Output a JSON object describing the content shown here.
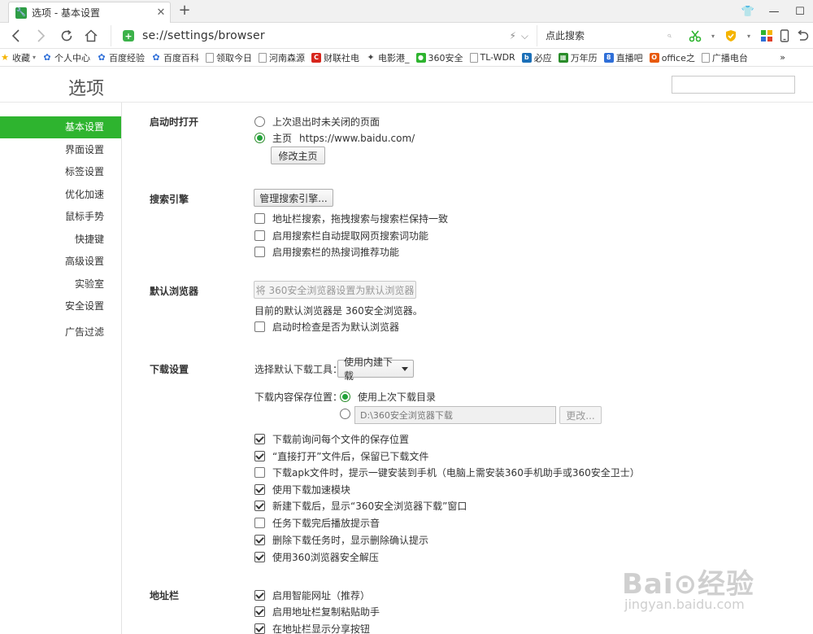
{
  "tab": {
    "title": "选项 - 基本设置",
    "close": "✕",
    "new": "+"
  },
  "window": {
    "skin": "👕",
    "minimize": "—",
    "maximize": "☐"
  },
  "toolbar": {
    "url": "se://settings/browser",
    "search_placeholder": "点此搜索",
    "lightning": "⚡",
    "dropdown": "⌵"
  },
  "bookmarks": [
    {
      "label": "收藏",
      "icon": "star-icon",
      "color": "#f5b400"
    },
    {
      "label": "个人中心",
      "icon": "paw-icon",
      "color": "#2f6fd8"
    },
    {
      "label": "百度经验",
      "icon": "paw-icon",
      "color": "#2f6fd8"
    },
    {
      "label": "百度百科",
      "icon": "paw-icon",
      "color": "#2f6fd8"
    },
    {
      "label": "领取今日",
      "icon": "page-icon",
      "color": "#9a9a9a"
    },
    {
      "label": "河南森源",
      "icon": "page-icon",
      "color": "#9a9a9a"
    },
    {
      "label": "财联社电",
      "icon": "c-icon",
      "color": "#d7261d"
    },
    {
      "label": "电影港_",
      "icon": "film-icon",
      "color": "#444444"
    },
    {
      "label": "360安全",
      "icon": "360-icon",
      "color": "#2eb42f"
    },
    {
      "label": "TL-WDR",
      "icon": "page-icon",
      "color": "#9a9a9a"
    },
    {
      "label": "必应",
      "icon": "bing-icon",
      "color": "#1b6fb8"
    },
    {
      "label": "万年历",
      "icon": "calendar-icon",
      "color": "#2a8c2a"
    },
    {
      "label": "直播吧",
      "icon": "live-icon",
      "color": "#2f6fd8"
    },
    {
      "label": "office之",
      "icon": "office-icon",
      "color": "#e85a0c"
    },
    {
      "label": "广播电台",
      "icon": "page-icon",
      "color": "#9a9a9a"
    }
  ],
  "bookmarks_more": "»",
  "header": {
    "title": "选项"
  },
  "sidebar": {
    "items": [
      {
        "label": "基本设置",
        "active": true
      },
      {
        "label": "界面设置"
      },
      {
        "label": "标签设置"
      },
      {
        "label": "优化加速"
      },
      {
        "label": "鼠标手势"
      },
      {
        "label": "快捷键"
      },
      {
        "label": "高级设置"
      },
      {
        "label": "实验室"
      },
      {
        "label": "安全设置"
      },
      {
        "label": "广告过滤"
      }
    ]
  },
  "startup": {
    "label": "启动时打开",
    "opt_last": "上次退出时未关闭的页面",
    "opt_home": "主页",
    "home_url": "https://www.baidu.com/",
    "modify_home": "修改主页"
  },
  "search_engine": {
    "label": "搜索引擎",
    "manage": "管理搜索引擎...",
    "opt1": "地址栏搜索，拖拽搜索与搜索栏保持一致",
    "opt2": "启用搜索栏自动提取网页搜索词功能",
    "opt3": "启用搜索栏的热搜词推荐功能"
  },
  "default_browser": {
    "label": "默认浏览器",
    "set_default": "将 360安全浏览器设置为默认浏览器",
    "current": "目前的默认浏览器是 360安全浏览器。",
    "check_startup": "启动时检查是否为默认浏览器"
  },
  "download": {
    "label": "下载设置",
    "tool_label": "选择默认下载工具：",
    "tool_value": "使用内建下载",
    "location_label": "下载内容保存位置：",
    "use_last": "使用上次下载目录",
    "path": "D:\\360安全浏览器下载",
    "change": "更改...",
    "opts": [
      {
        "text": "下载前询问每个文件的保存位置",
        "checked": true
      },
      {
        "text": "“直接打开”文件后，保留已下载文件",
        "checked": true
      },
      {
        "text": "下载apk文件时，提示一键安装到手机（电脑上需安装360手机助手或360安全卫士）",
        "checked": false
      },
      {
        "text": "使用下载加速模块",
        "checked": true
      },
      {
        "text": "新建下载后，显示“360安全浏览器下载”窗口",
        "checked": true
      },
      {
        "text": "任务下载完后播放提示音",
        "checked": false
      },
      {
        "text": "删除下载任务时，显示删除确认提示",
        "checked": true
      },
      {
        "text": "使用360浏览器安全解压",
        "checked": true
      }
    ]
  },
  "addressbar": {
    "label": "地址栏",
    "opts": [
      {
        "text": "启用智能网址（推荐）",
        "checked": true
      },
      {
        "text": "启用地址栏复制粘贴助手",
        "checked": true
      },
      {
        "text": "在地址栏显示分享按钮",
        "checked": true
      }
    ]
  },
  "watermark": {
    "main": "Bai⊙经验",
    "sub": "jingyan.baidu.com"
  }
}
